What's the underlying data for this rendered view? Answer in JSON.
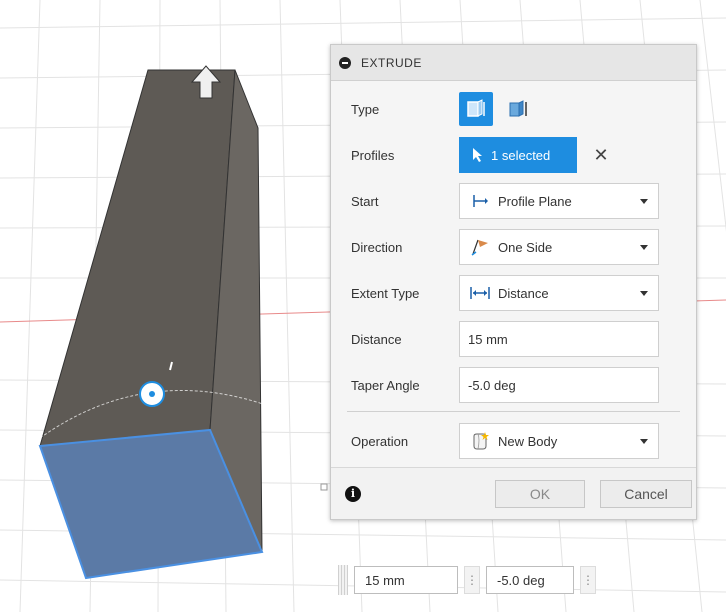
{
  "colors": {
    "accent": "#1e8de0",
    "body_face": "#5e5a55",
    "selected_face": "#5b7aa6",
    "grid": "#e3e3e3",
    "axis_red": "#e88a8a"
  },
  "dialog": {
    "title": "EXTRUDE",
    "rows": {
      "type": {
        "label": "Type",
        "icons": [
          "extrude-solid-icon",
          "extrude-thin-icon"
        ]
      },
      "profiles": {
        "label": "Profiles",
        "value": "1 selected",
        "clear_icon": "close-icon"
      },
      "start": {
        "label": "Start",
        "value": "Profile Plane",
        "icon": "profile-plane-icon"
      },
      "direction": {
        "label": "Direction",
        "value": "One Side",
        "icon": "one-side-flag-icon"
      },
      "extent_type": {
        "label": "Extent Type",
        "value": "Distance",
        "icon": "distance-arrows-icon"
      },
      "distance": {
        "label": "Distance",
        "value": "15 mm"
      },
      "taper_angle": {
        "label": "Taper Angle",
        "value": "-5.0 deg"
      },
      "operation": {
        "label": "Operation",
        "value": "New Body",
        "icon": "new-body-icon"
      }
    },
    "footer": {
      "ok_label": "OK",
      "cancel_label": "Cancel",
      "info_icon": "info-icon"
    }
  },
  "hud": {
    "distance_value": "15 mm",
    "angle_value": "-5.0 deg"
  }
}
